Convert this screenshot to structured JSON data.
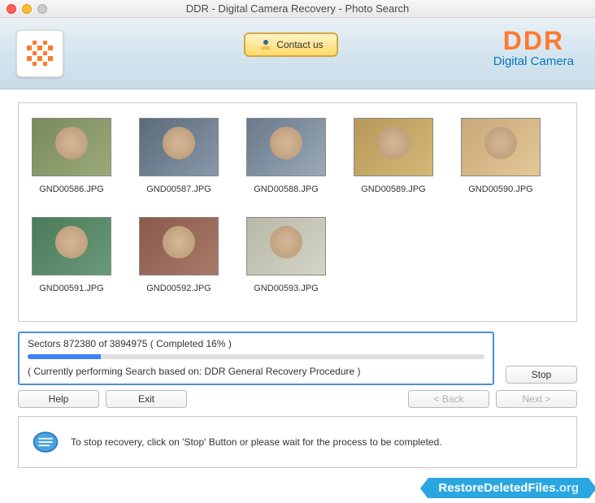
{
  "window": {
    "title": "DDR - Digital Camera Recovery - Photo Search"
  },
  "header": {
    "contact_label": "Contact us",
    "brand": "DDR",
    "brand_sub": "Digital Camera"
  },
  "thumbnails": [
    {
      "filename": "GND00586.JPG"
    },
    {
      "filename": "GND00587.JPG"
    },
    {
      "filename": "GND00588.JPG"
    },
    {
      "filename": "GND00589.JPG"
    },
    {
      "filename": "GND00590.JPG"
    },
    {
      "filename": "GND00591.JPG"
    },
    {
      "filename": "GND00592.JPG"
    },
    {
      "filename": "GND00593.JPG"
    }
  ],
  "progress": {
    "sectors_current": 872380,
    "sectors_total": 3894975,
    "percent": 16,
    "sectors_text": "Sectors 872380 of 3894975   ( Completed 16% )",
    "search_text": "( Currently performing Search based on: DDR General Recovery Procedure )"
  },
  "buttons": {
    "stop": "Stop",
    "help": "Help",
    "exit": "Exit",
    "back": "< Back",
    "next": "Next >"
  },
  "info": {
    "text": "To stop recovery, click on 'Stop' Button or please wait for the process to be completed."
  },
  "ribbon": {
    "text": "RestoreDeletedFiles",
    "suffix": ".org"
  }
}
